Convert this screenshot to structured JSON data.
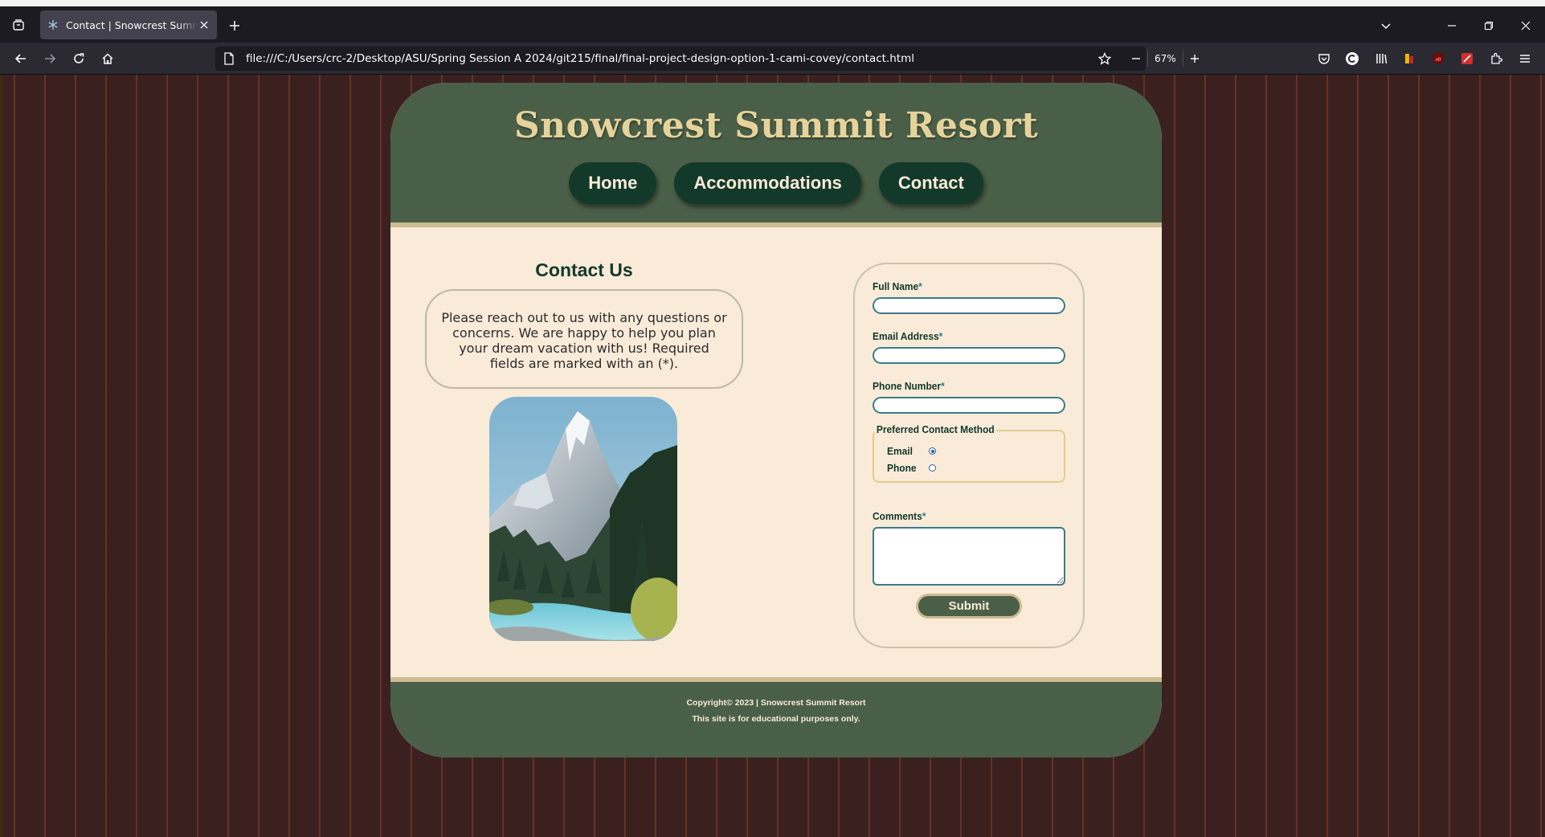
{
  "browser": {
    "tab_title": "Contact | Snowcrest Summit Resort",
    "url": "file:///C:/Users/crc-2/Desktop/ASU/Spring Session A 2024/git215/final/final-project-design-option-1-cami-covey/contact.html",
    "zoom": "67%"
  },
  "site": {
    "title": "Snowcrest Summit Resort",
    "nav": [
      "Home",
      "Accommodations",
      "Contact"
    ]
  },
  "contact": {
    "heading": "Contact Us",
    "intro": "Please reach out to us with any questions or concerns. We are happy to help you plan your dream vacation with us! Required fields are marked with an (*)."
  },
  "form": {
    "full_name_label": "Full Name",
    "email_label": "Email Address",
    "phone_label": "Phone Number",
    "required_mark": "*",
    "method_legend": "Preferred Contact Method",
    "method_options": [
      "Email",
      "Phone"
    ],
    "method_selected": "Email",
    "comments_label": "Comments",
    "submit_label": "Submit"
  },
  "footer": {
    "copyright": "Copyright© 2023 | Snowcrest Summit Resort",
    "note": "This site is for educational purposes only."
  },
  "colors": {
    "header_green": "#4a5f48",
    "nav_button": "#12392a",
    "title_gold": "#e6d39b",
    "page_cream": "#f9ebd8",
    "background_brown": "#3a2120"
  },
  "icons": [
    "tab-list-icon",
    "snowflake-favicon",
    "close-icon",
    "plus-icon",
    "chevron-down-icon",
    "minimize-icon",
    "restore-icon",
    "back-icon",
    "forward-icon",
    "reload-icon",
    "home-icon",
    "page-icon",
    "star-icon",
    "pocket-icon",
    "extensions-icon",
    "menu-icon"
  ]
}
